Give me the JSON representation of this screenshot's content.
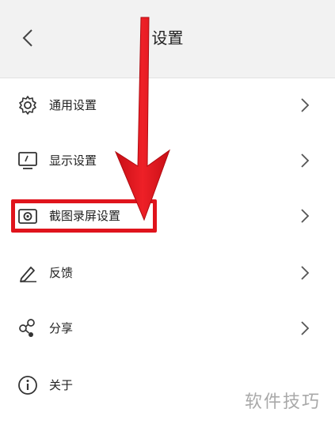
{
  "header": {
    "title": "设置",
    "back_icon": "chevron-left-icon"
  },
  "menu": {
    "items": [
      {
        "id": "general",
        "label": "通用设置",
        "icon": "gear-icon"
      },
      {
        "id": "display",
        "label": "显示设置",
        "icon": "monitor-icon"
      },
      {
        "id": "screenshot",
        "label": "截图录屏设置",
        "icon": "camera-icon"
      },
      {
        "id": "feedback",
        "label": "反馈",
        "icon": "pencil-icon"
      },
      {
        "id": "share",
        "label": "分享",
        "icon": "share-icon"
      },
      {
        "id": "about",
        "label": "关于",
        "icon": "info-icon"
      }
    ]
  },
  "annotation": {
    "highlight_color": "#e0141c"
  },
  "watermark": {
    "text": "软件技巧"
  }
}
